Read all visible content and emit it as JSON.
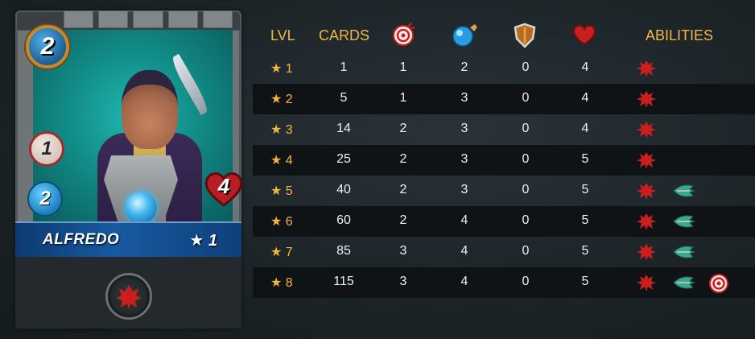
{
  "card": {
    "name": "ALFREDO",
    "mana": "2",
    "level": "★ 1",
    "melee": "1",
    "magic": "2",
    "health": "4",
    "ability_icon": "enrage-icon",
    "colors": {
      "banner": "#175aa0",
      "art_bg": "#128b87",
      "mana_ring": "#c58a2e"
    }
  },
  "table": {
    "headers": {
      "lvl": "LVL",
      "cards": "CARDS",
      "melee_icon": "melee-attack-icon",
      "magic_icon": "magic-attack-icon",
      "armor_icon": "armor-shield-icon",
      "health_icon": "health-heart-icon",
      "abilities": "ABILITIES"
    },
    "rows": [
      {
        "lvl": "★ 1",
        "cards": "1",
        "melee": "1",
        "magic": "2",
        "armor": "0",
        "health": "4",
        "abilities": [
          "enrage-icon"
        ]
      },
      {
        "lvl": "★ 2",
        "cards": "5",
        "melee": "1",
        "magic": "3",
        "armor": "0",
        "health": "4",
        "abilities": [
          "enrage-icon"
        ]
      },
      {
        "lvl": "★ 3",
        "cards": "14",
        "melee": "2",
        "magic": "3",
        "armor": "0",
        "health": "4",
        "abilities": [
          "enrage-icon"
        ]
      },
      {
        "lvl": "★ 4",
        "cards": "25",
        "melee": "2",
        "magic": "3",
        "armor": "0",
        "health": "5",
        "abilities": [
          "enrage-icon"
        ]
      },
      {
        "lvl": "★ 5",
        "cards": "40",
        "melee": "2",
        "magic": "3",
        "armor": "0",
        "health": "5",
        "abilities": [
          "enrage-icon",
          "dodge-icon"
        ]
      },
      {
        "lvl": "★ 6",
        "cards": "60",
        "melee": "2",
        "magic": "4",
        "armor": "0",
        "health": "5",
        "abilities": [
          "enrage-icon",
          "dodge-icon"
        ]
      },
      {
        "lvl": "★ 7",
        "cards": "85",
        "melee": "3",
        "magic": "4",
        "armor": "0",
        "health": "5",
        "abilities": [
          "enrage-icon",
          "dodge-icon"
        ]
      },
      {
        "lvl": "★ 8",
        "cards": "115",
        "melee": "3",
        "magic": "4",
        "armor": "0",
        "health": "5",
        "abilities": [
          "enrage-icon",
          "dodge-icon",
          "target-icon"
        ]
      }
    ],
    "colors": {
      "header": "#f3b646",
      "row_alt": "#0f1316"
    }
  }
}
